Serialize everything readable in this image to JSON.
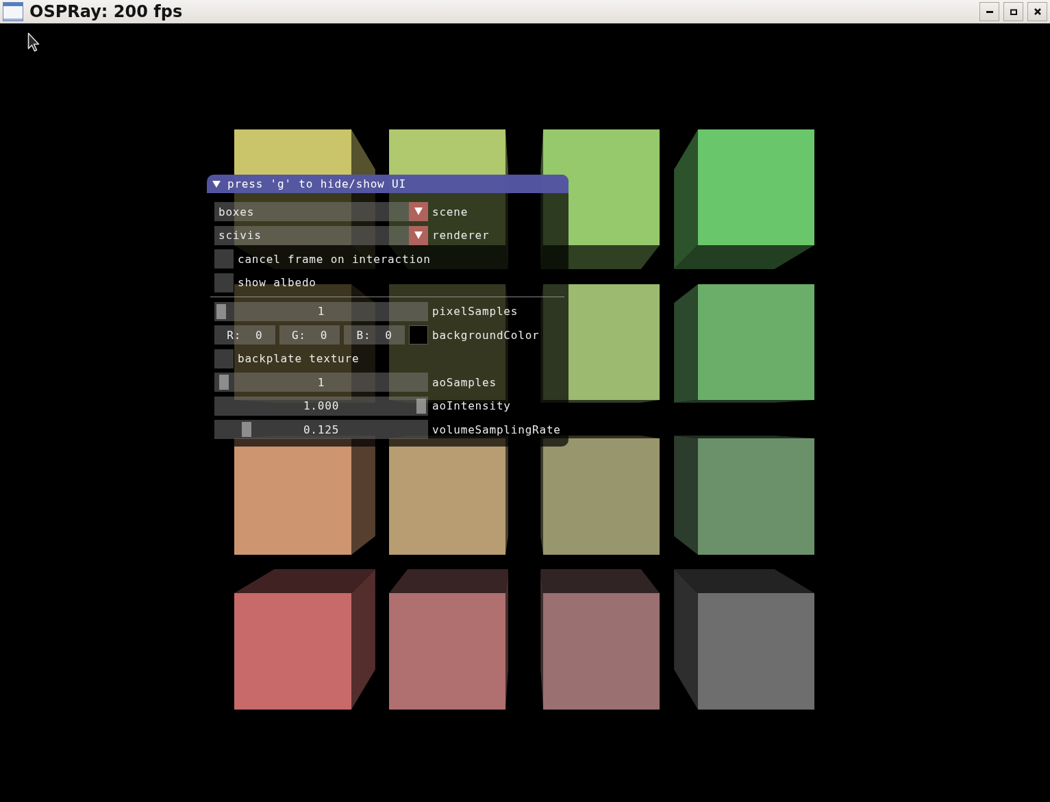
{
  "window": {
    "title": "OSPRay: 200 fps"
  },
  "panel": {
    "title": "press 'g' to hide/show UI",
    "expanded": true,
    "controls": [
      {
        "kind": "combo",
        "value": "boxes",
        "label": "scene"
      },
      {
        "kind": "combo",
        "value": "scivis",
        "label": "renderer"
      },
      {
        "kind": "checkbox",
        "text": "cancel frame on interaction",
        "checked": false
      },
      {
        "kind": "checkbox",
        "text": "show albedo",
        "checked": false
      },
      {
        "kind": "separator"
      },
      {
        "kind": "slider",
        "value": "1",
        "level": 0,
        "label": "pixelSamples"
      },
      {
        "kind": "color",
        "channels": [
          "R:  0",
          "G:  0",
          "B:  0"
        ],
        "color": "#000000",
        "label": "backgroundColor"
      },
      {
        "kind": "checkbox",
        "text": "backplate texture",
        "checked": false
      },
      {
        "kind": "slider",
        "value": "1",
        "level": 0.015,
        "label": "aoSamples"
      },
      {
        "kind": "slider",
        "value": "1.000",
        "level": 1,
        "label": "aoIntensity"
      },
      {
        "kind": "slider",
        "value": "0.125",
        "level": 0.125,
        "label": "volumeSamplingRate"
      }
    ]
  }
}
